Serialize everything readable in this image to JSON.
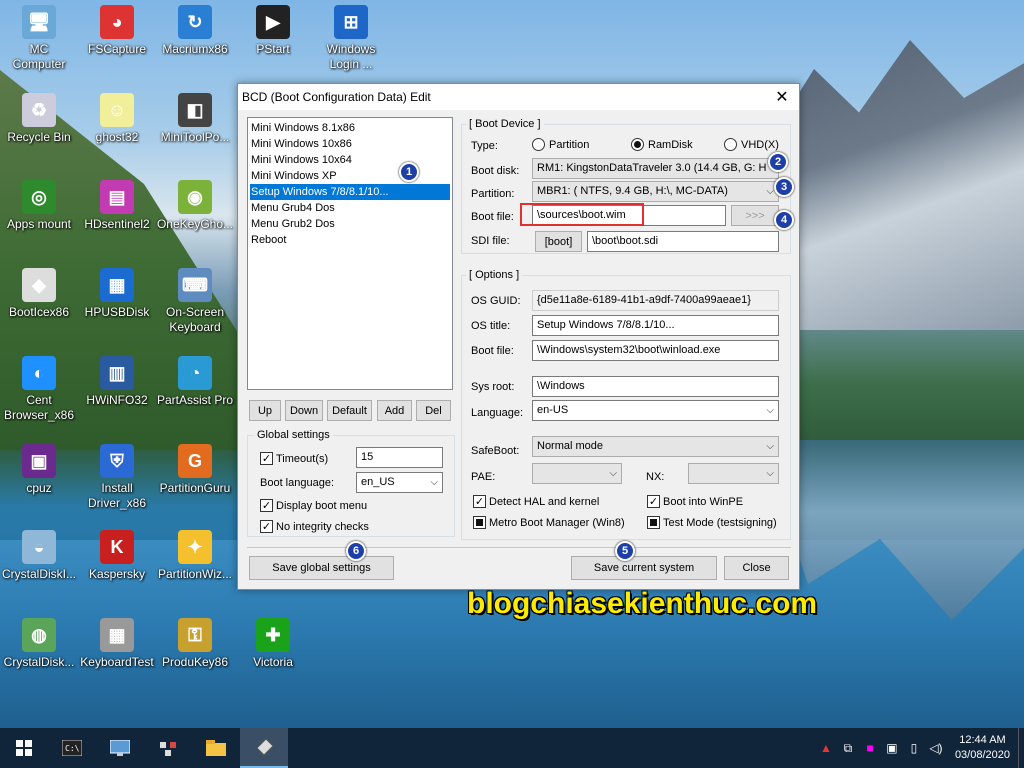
{
  "window": {
    "title": "BCD (Boot Configuration Data) Edit",
    "close_glyph": "✕"
  },
  "entries": [
    {
      "label": "Mini Windows 8.1x86",
      "selected": false
    },
    {
      "label": "Mini Windows 10x86",
      "selected": false
    },
    {
      "label": "Mini Windows 10x64",
      "selected": false
    },
    {
      "label": "Mini Windows XP",
      "selected": false
    },
    {
      "label": "Setup Windows 7/8/8.1/10...",
      "selected": true
    },
    {
      "label": "Menu Grub4 Dos",
      "selected": false
    },
    {
      "label": "Menu Grub2 Dos",
      "selected": false
    },
    {
      "label": "Reboot",
      "selected": false
    }
  ],
  "list_buttons": {
    "up": "Up",
    "down": "Down",
    "default": "Default",
    "add": "Add",
    "del": "Del"
  },
  "global": {
    "title": "Global settings",
    "timeout_label": "Timeout(s)",
    "timeout_value": "15",
    "timeout_checked": true,
    "lang_label": "Boot language:",
    "lang_value": "en_US",
    "display_menu_label": "Display boot menu",
    "display_menu_checked": true,
    "no_integrity_label": "No integrity checks",
    "no_integrity_checked": true
  },
  "boot_device": {
    "title": "[ Boot Device ]",
    "type_label": "Type:",
    "type_options": [
      "Partition",
      "RamDisk",
      "VHD(X)"
    ],
    "type_selected": "RamDisk",
    "disk_label": "Boot disk:",
    "disk_value": "RM1: KingstonDataTraveler 3.0 (14.4 GB, G: H",
    "partition_label": "Partition:",
    "partition_value": "MBR1: ( NTFS,   9.4 GB, H:\\, MC-DATA)",
    "bootfile_label": "Boot file:",
    "bootfile_value": "\\sources\\boot.wim",
    "browse_label": ">>>",
    "sdi_label": "SDI file:",
    "sdi_btn": "[boot]",
    "sdi_value": "\\boot\\boot.sdi"
  },
  "options": {
    "title": "[ Options ]",
    "guid_label": "OS GUID:",
    "guid_value": "{d5e11a8e-6189-41b1-a9df-7400a99aeae1}",
    "title_label": "OS title:",
    "title_value": "Setup Windows 7/8/8.1/10...",
    "bootfile_label": "Boot file:",
    "bootfile_value": "\\Windows\\system32\\boot\\winload.exe",
    "sysroot_label": "Sys root:",
    "sysroot_value": "\\Windows",
    "language_label": "Language:",
    "language_value": "en-US",
    "safeboot_label": "SafeBoot:",
    "safeboot_value": "Normal mode",
    "pae_label": "PAE:",
    "nx_label": "NX:",
    "detect_hal_label": "Detect HAL and kernel",
    "detect_hal_checked": true,
    "winpe_label": "Boot into WinPE",
    "winpe_checked": true,
    "metro_label": "Metro Boot Manager (Win8)",
    "metro_checked": "partial",
    "testmode_label": "Test Mode (testsigning)",
    "testmode_checked": "partial"
  },
  "bottom_buttons": {
    "save_global": "Save global settings",
    "save_current": "Save current system",
    "close": "Close"
  },
  "badges": [
    "1",
    "2",
    "3",
    "4",
    "5",
    "6"
  ],
  "watermark": "blogchiasekienthuc.com",
  "desktop_icons": [
    {
      "label": "MC\nComputer",
      "icon": "computer-icon"
    },
    {
      "label": "FSCapture",
      "icon": "fscapture-icon"
    },
    {
      "label": "Macriumx86",
      "icon": "macrium-icon"
    },
    {
      "label": "PStart",
      "icon": "pstart-icon"
    },
    {
      "label": "Windows\nLogin ...",
      "icon": "windows-login-icon"
    },
    {
      "label": "Recycle Bin",
      "icon": "recycle-bin-icon"
    },
    {
      "label": "ghost32",
      "icon": "ghost-icon"
    },
    {
      "label": "MiniToolPo...",
      "icon": "minitool-icon"
    },
    {
      "label": "Apps mount",
      "icon": "apps-mount-icon"
    },
    {
      "label": "HDsentinel2",
      "icon": "hdsentinel-icon"
    },
    {
      "label": "OneKeyGho...",
      "icon": "onekeyghost-icon"
    },
    {
      "label": "BootIcex86",
      "icon": "bootice-icon"
    },
    {
      "label": "HPUSBDisk",
      "icon": "hpusbdisk-icon"
    },
    {
      "label": "On-Screen\nKeyboard",
      "icon": "keyboard-icon"
    },
    {
      "label": "Cent\nBrowser_x86",
      "icon": "cent-browser-icon"
    },
    {
      "label": "HWiNFO32",
      "icon": "hwinfo-icon"
    },
    {
      "label": "PartAssist Pro",
      "icon": "partassist-icon"
    },
    {
      "label": "cpuz",
      "icon": "cpuz-icon"
    },
    {
      "label": "Install\nDriver_x86",
      "icon": "install-driver-icon"
    },
    {
      "label": "PartitionGuru",
      "icon": "partitionguru-icon"
    },
    {
      "label": "CrystalDiskI...",
      "icon": "crystaldiskinfo-icon"
    },
    {
      "label": "Kaspersky",
      "icon": "kaspersky-icon"
    },
    {
      "label": "PartitionWiz...",
      "icon": "partitionwizard-icon"
    },
    {
      "label": "CrystalDisk...",
      "icon": "crystaldiskmark-icon"
    },
    {
      "label": "KeyboardTest",
      "icon": "keyboardtest-icon"
    },
    {
      "label": "ProduKey86",
      "icon": "produkey-icon"
    },
    {
      "label": "Victoria",
      "icon": "victoria-icon"
    }
  ],
  "taskbar": {
    "clock_time": "12:44 AM",
    "clock_date": "03/08/2020"
  }
}
